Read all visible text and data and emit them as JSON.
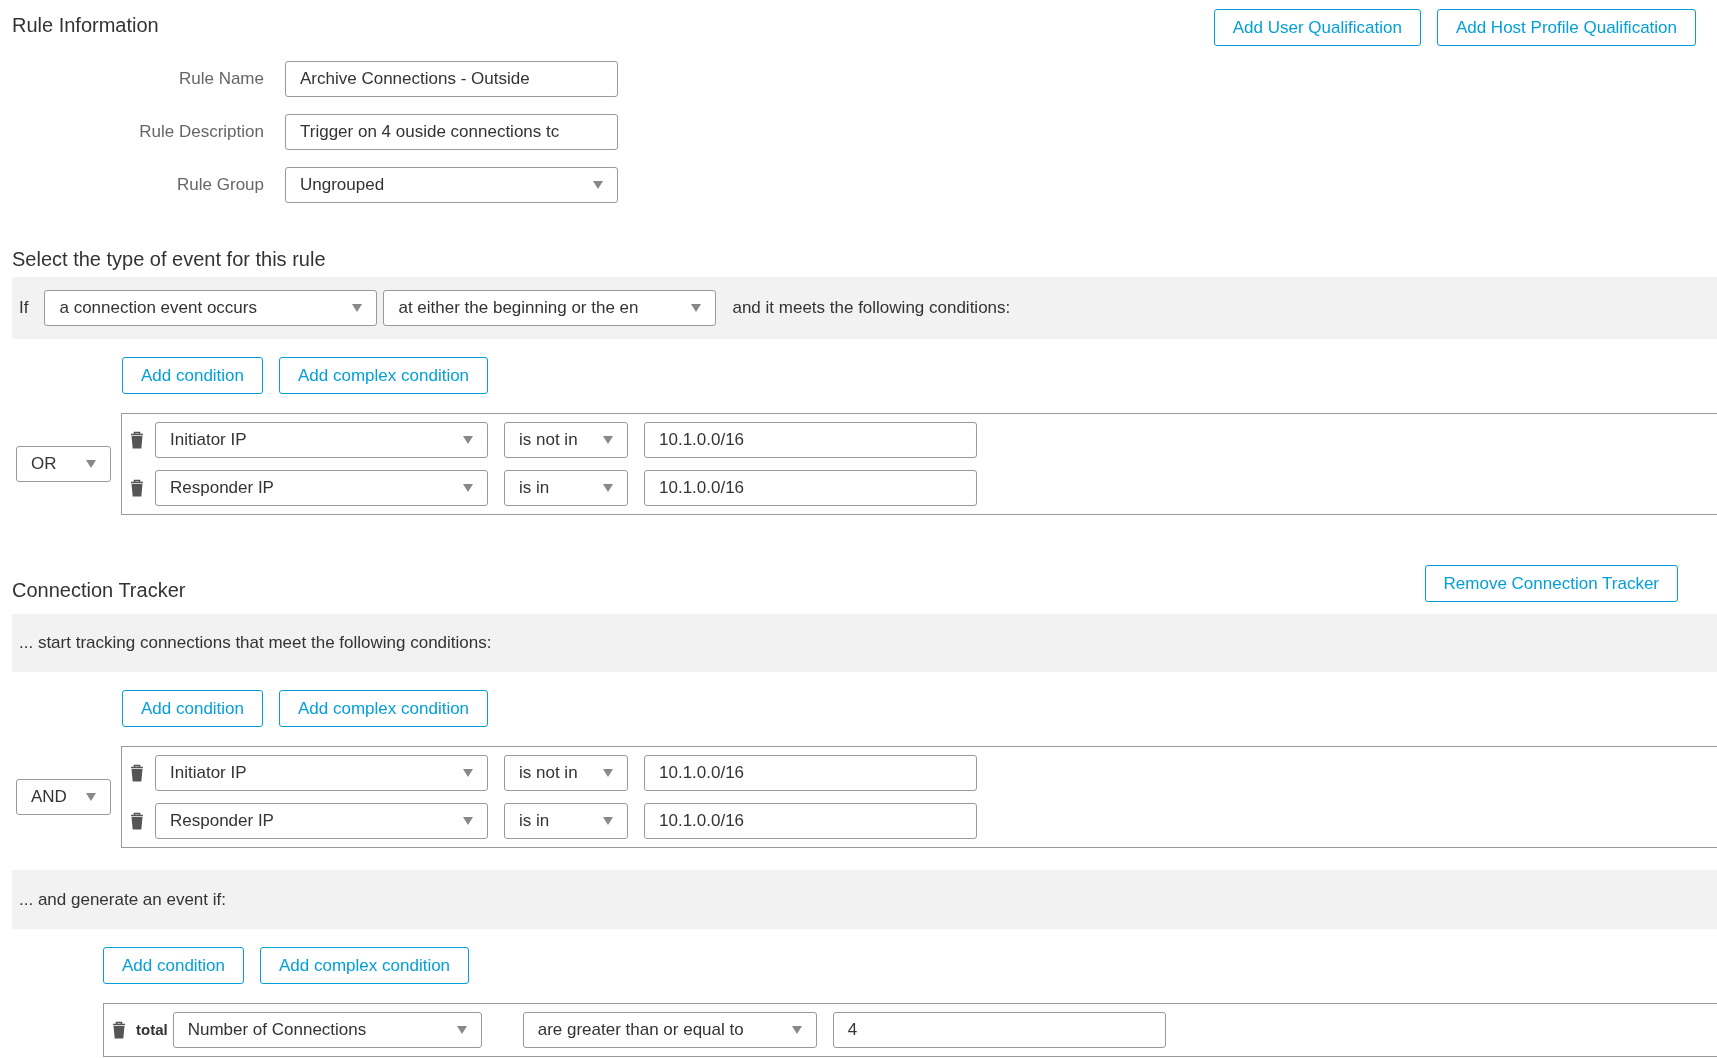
{
  "rule_information": {
    "title": "Rule Information",
    "buttons": [
      "Add User Qualification",
      "Add Host Profile Qualification"
    ],
    "fields": [
      {
        "label": "Rule Name",
        "kind": "text",
        "value": "Archive Connections - Outside"
      },
      {
        "label": "Rule Description",
        "kind": "text",
        "value": "Trigger on 4 ouside connections tc"
      },
      {
        "label": "Rule Group",
        "kind": "select",
        "value": "Ungrouped"
      }
    ]
  },
  "event_type": {
    "title": "Select the type of event for this rule",
    "prefix": "If",
    "selects": [
      "a connection event occurs",
      "at either the beginning or the en"
    ],
    "suffix": "and it meets the following conditions:",
    "buttons": [
      "Add condition",
      "Add complex condition"
    ],
    "operator": "OR",
    "rows": [
      {
        "field": "Initiator IP",
        "operator": "is not in",
        "value": "10.1.0.0/16"
      },
      {
        "field": "Responder IP",
        "operator": "is in",
        "value": "10.1.0.0/16"
      }
    ]
  },
  "connection_tracker": {
    "title": "Connection Tracker",
    "button": "Remove Connection Tracker",
    "tracking_text": "... start tracking connections that meet the following conditions:",
    "buttons": [
      "Add condition",
      "Add complex condition"
    ],
    "operator": "AND",
    "rows": [
      {
        "field": "Initiator IP",
        "operator": "is not in",
        "value": "10.1.0.0/16"
      },
      {
        "field": "Responder IP",
        "operator": "is in",
        "value": "10.1.0.0/16"
      }
    ],
    "event_text": "... and generate an event if:",
    "event_buttons": [
      "Add condition",
      "Add complex condition"
    ],
    "event_rows": [
      {
        "label": "total",
        "field": "Number of Connections",
        "operator": "are greater than or equal to",
        "value": "4"
      }
    ]
  }
}
